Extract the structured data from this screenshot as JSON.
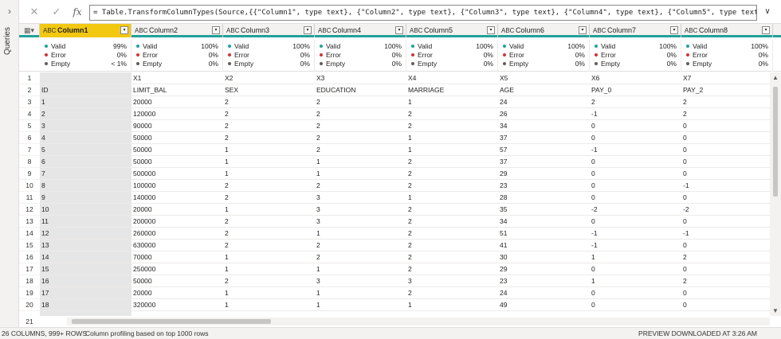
{
  "queries": {
    "label": "Queries",
    "expand_icon": "chevron-right-icon"
  },
  "formula": {
    "cancel_icon": "close-icon",
    "commit_icon": "check-icon",
    "fx_label": "fx",
    "text": "= Table.TransformColumnTypes(Source,{{\"Column1\", type text}, {\"Column2\", type text}, {\"Column3\", type text}, {\"Column4\", type text}, {\"Column5\", type text}, {\"Column6\", type"
  },
  "columns": [
    {
      "name": "Column1",
      "selected": true,
      "profile": {
        "valid": "99%",
        "error": "0%",
        "empty": "< 1%"
      }
    },
    {
      "name": "Column2",
      "selected": false,
      "profile": {
        "valid": "100%",
        "error": "0%",
        "empty": "0%"
      }
    },
    {
      "name": "Column3",
      "selected": false,
      "profile": {
        "valid": "100%",
        "error": "0%",
        "empty": "0%"
      }
    },
    {
      "name": "Column4",
      "selected": false,
      "profile": {
        "valid": "100%",
        "error": "0%",
        "empty": "0%"
      }
    },
    {
      "name": "Column5",
      "selected": false,
      "profile": {
        "valid": "100%",
        "error": "0%",
        "empty": "0%"
      }
    },
    {
      "name": "Column6",
      "selected": false,
      "profile": {
        "valid": "100%",
        "error": "0%",
        "empty": "0%"
      }
    },
    {
      "name": "Column7",
      "selected": false,
      "profile": {
        "valid": "100%",
        "error": "0%",
        "empty": "0%"
      }
    },
    {
      "name": "Column8",
      "selected": false,
      "profile": {
        "valid": "100%",
        "error": "0%",
        "empty": "0%"
      }
    }
  ],
  "profile_labels": {
    "valid": "Valid",
    "error": "Error",
    "empty": "Empty"
  },
  "type_icon_label": "ABC",
  "rows": [
    [
      "1",
      "",
      "X1",
      "X2",
      "X3",
      "X4",
      "X5",
      "X6",
      "X7"
    ],
    [
      "2",
      "ID",
      "LIMIT_BAL",
      "SEX",
      "EDUCATION",
      "MARRIAGE",
      "AGE",
      "PAY_0",
      "PAY_2"
    ],
    [
      "3",
      "1",
      "20000",
      "2",
      "2",
      "1",
      "24",
      "2",
      "2"
    ],
    [
      "4",
      "2",
      "120000",
      "2",
      "2",
      "2",
      "26",
      "-1",
      "2"
    ],
    [
      "5",
      "3",
      "90000",
      "2",
      "2",
      "2",
      "34",
      "0",
      "0"
    ],
    [
      "6",
      "4",
      "50000",
      "2",
      "2",
      "1",
      "37",
      "0",
      "0"
    ],
    [
      "7",
      "5",
      "50000",
      "1",
      "2",
      "1",
      "57",
      "-1",
      "0"
    ],
    [
      "8",
      "6",
      "50000",
      "1",
      "1",
      "2",
      "37",
      "0",
      "0"
    ],
    [
      "9",
      "7",
      "500000",
      "1",
      "1",
      "2",
      "29",
      "0",
      "0"
    ],
    [
      "10",
      "8",
      "100000",
      "2",
      "2",
      "2",
      "23",
      "0",
      "-1"
    ],
    [
      "11",
      "9",
      "140000",
      "2",
      "3",
      "1",
      "28",
      "0",
      "0"
    ],
    [
      "12",
      "10",
      "20000",
      "1",
      "3",
      "2",
      "35",
      "-2",
      "-2"
    ],
    [
      "13",
      "11",
      "200000",
      "2",
      "3",
      "2",
      "34",
      "0",
      "0"
    ],
    [
      "14",
      "12",
      "260000",
      "2",
      "1",
      "2",
      "51",
      "-1",
      "-1"
    ],
    [
      "15",
      "13",
      "630000",
      "2",
      "2",
      "2",
      "41",
      "-1",
      "0"
    ],
    [
      "16",
      "14",
      "70000",
      "1",
      "2",
      "2",
      "30",
      "1",
      "2"
    ],
    [
      "17",
      "15",
      "250000",
      "1",
      "1",
      "2",
      "29",
      "0",
      "0"
    ],
    [
      "18",
      "16",
      "50000",
      "2",
      "3",
      "3",
      "23",
      "1",
      "2"
    ],
    [
      "19",
      "17",
      "20000",
      "1",
      "1",
      "2",
      "24",
      "0",
      "0"
    ],
    [
      "20",
      "18",
      "320000",
      "1",
      "1",
      "1",
      "49",
      "0",
      "0"
    ]
  ],
  "last_row_number": "21",
  "status": {
    "counts": "26 COLUMNS, 999+ ROWS",
    "profiling": "Column profiling based on top 1000 rows",
    "preview": "PREVIEW DOWNLOADED AT 3:26 AM"
  }
}
